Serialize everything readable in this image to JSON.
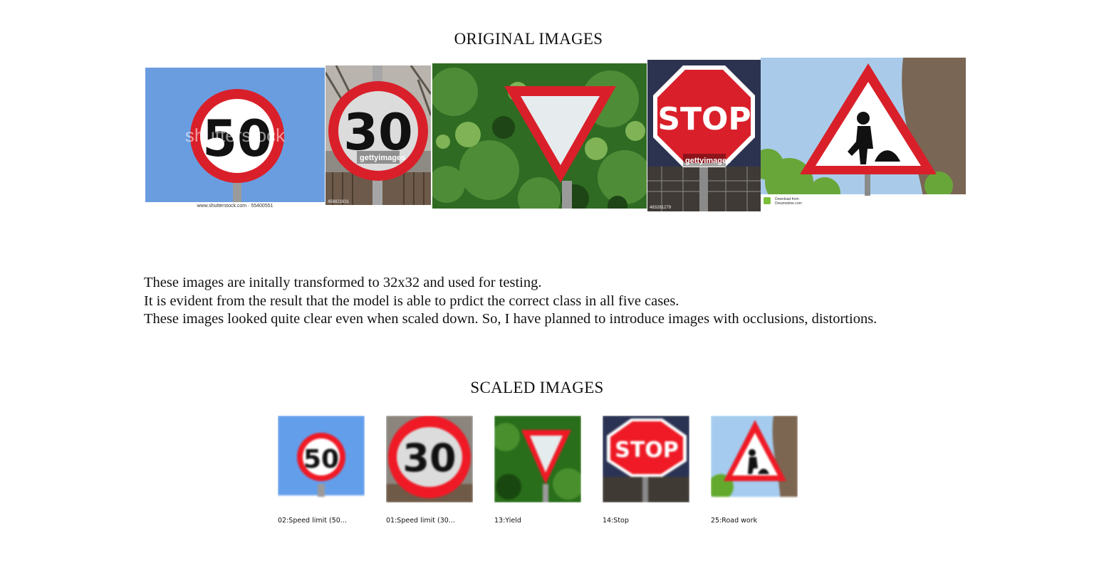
{
  "titles": {
    "original": "ORIGINAL IMAGES",
    "scaled": "SCALED IMAGES"
  },
  "original_images": {
    "img_50": {
      "sign_text": "50",
      "watermark": "shutterstock",
      "credit": "www.shutterstock.com · 55400551"
    },
    "img_30": {
      "sign_text": "30",
      "watermark": "gettyimages",
      "credit": "458821631"
    },
    "img_yield": {},
    "img_stop": {
      "sign_text": "STOP",
      "watermark": "gettyimages",
      "credit": "483281279"
    },
    "img_roadwork": {
      "credit_line1": "Download from",
      "credit_line2": "Dreamstime.com"
    }
  },
  "caption": {
    "line1": "These images are initally transformed to 32x32 and used for testing.",
    "line2": "It is evident from the result that the model is able to prdict the correct class in all five cases.",
    "line3": "These images looked quite clear even when scaled down. So, I have planned to introduce images with occlusions, distortions."
  },
  "scaled_images": [
    {
      "label": "02:Speed limit (50...",
      "sign_text": "50"
    },
    {
      "label": "01:Speed limit (30...",
      "sign_text": "30"
    },
    {
      "label": "13:Yield"
    },
    {
      "label": "14:Stop",
      "sign_text": "STOP"
    },
    {
      "label": "25:Road work"
    }
  ],
  "colors": {
    "sign_red": "#d9202a",
    "sky_blue": "#6a9de0",
    "foliage": "#2f6b22"
  }
}
